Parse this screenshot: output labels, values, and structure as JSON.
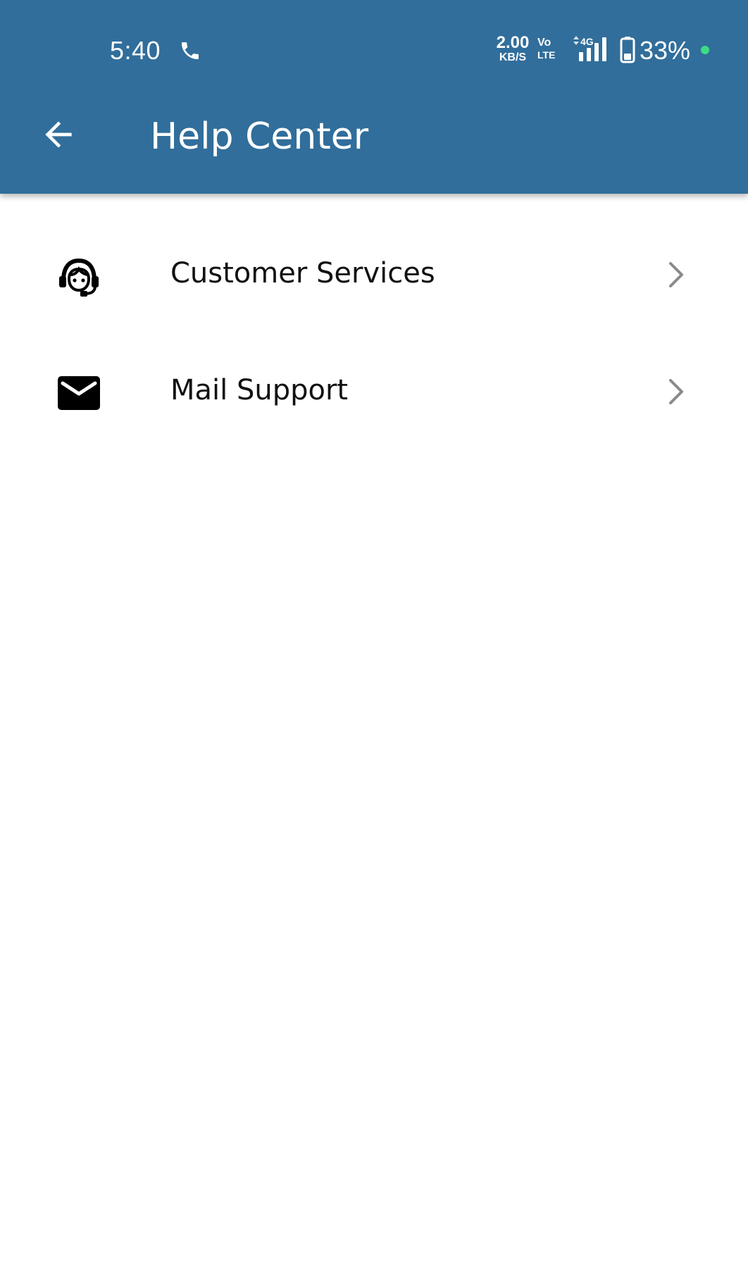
{
  "status_bar": {
    "time": "5:40",
    "net_speed_value": "2.00",
    "net_speed_unit": "KB/S",
    "volte_top": "Vo",
    "volte_bottom": "LTE",
    "network_type": "4G",
    "battery_percent": "33%",
    "icons": [
      "phone-icon",
      "signal-icon",
      "battery-icon"
    ]
  },
  "toolbar": {
    "title": "Help Center",
    "back_icon": "arrow-left-icon"
  },
  "menu": {
    "items": [
      {
        "label": "Customer Services",
        "icon": "headset-agent-icon"
      },
      {
        "label": "Mail Support",
        "icon": "mail-icon"
      }
    ]
  },
  "colors": {
    "appbar": "#316e9b",
    "text_primary": "#111111",
    "chevron": "#8a8a8a",
    "status_dot": "#3ddc84"
  }
}
